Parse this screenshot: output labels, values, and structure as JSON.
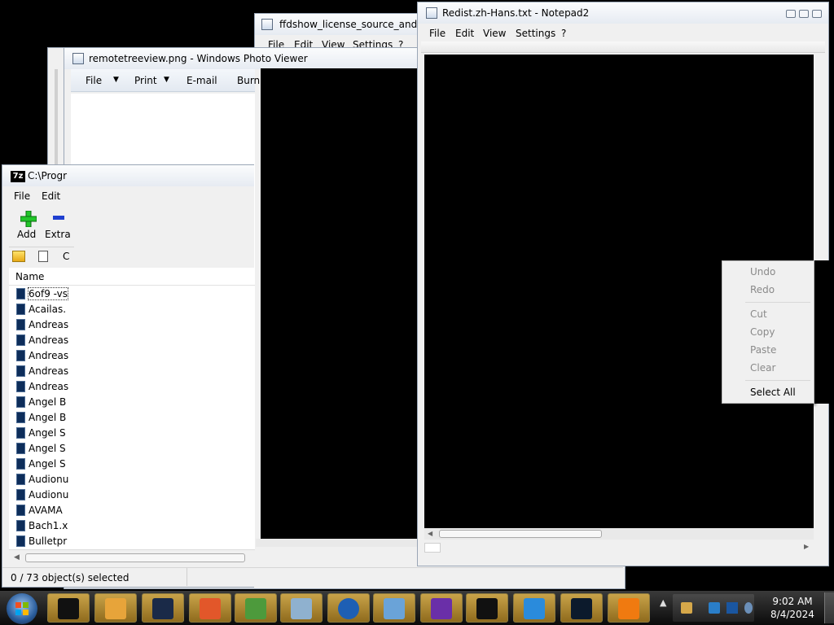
{
  "windows": {
    "back_window": {},
    "ffdshow": {
      "title": "ffdshow_license_source_and_cre",
      "menu": [
        "File",
        "Edit",
        "View",
        "Settings",
        "?"
      ]
    },
    "photo_viewer": {
      "title": "remotetreeview.png - Windows Photo Viewer",
      "menu": {
        "file": "File",
        "print": "Print",
        "email": "E-mail",
        "burn": "Burn"
      }
    },
    "sevenzip": {
      "title": "C:\\Progr",
      "menu": [
        "File",
        "Edit"
      ],
      "toolbar": {
        "add": "Add",
        "extract": "Extra"
      },
      "address_partial": "C",
      "column_name": "Name",
      "files": [
        "6of9 -vs",
        "Acailas.",
        "Andreas",
        "Andreas",
        "Andreas",
        "Andreas",
        "Andreas",
        "Angel B",
        "Angel B",
        "Angel S",
        "Angel S",
        "Angel S",
        "Audionu",
        "Audionu",
        "AVAMA",
        "Bach1.x",
        "Bulletpr"
      ],
      "status": "0 / 73 object(s) selected"
    },
    "notepad2": {
      "title": "Redist.zh-Hans.txt - Notepad2",
      "menu": [
        "File",
        "Edit",
        "View",
        "Settings",
        "?"
      ]
    }
  },
  "context_menu": {
    "items": [
      {
        "label": "Undo",
        "enabled": false
      },
      {
        "label": "Redo",
        "enabled": false
      },
      {
        "label": "Cut",
        "enabled": false
      },
      {
        "label": "Copy",
        "enabled": false
      },
      {
        "label": "Paste",
        "enabled": false
      },
      {
        "label": "Clear",
        "enabled": false
      },
      {
        "label": "Select All",
        "enabled": true
      }
    ]
  },
  "taskbar": {
    "start_icon": "windows-start-orb",
    "apps": [
      "dark-box-app-icon",
      "media-player-icon",
      "globe-dark-icon",
      "firefox-icon",
      "paint-palette-icon",
      "photo-frame-icon",
      "help-icon",
      "image-viewer-icon",
      "visual-studio-icon",
      "7zip-icon",
      "internet-explorer-icon",
      "monitor-app-icon",
      "vlc-icon"
    ],
    "clock_time": "9:02 AM",
    "clock_date": "8/4/2024"
  },
  "colors": {
    "desktop": "#000000",
    "taskbar_button": "#b08a30",
    "selection": "#3399ff"
  }
}
